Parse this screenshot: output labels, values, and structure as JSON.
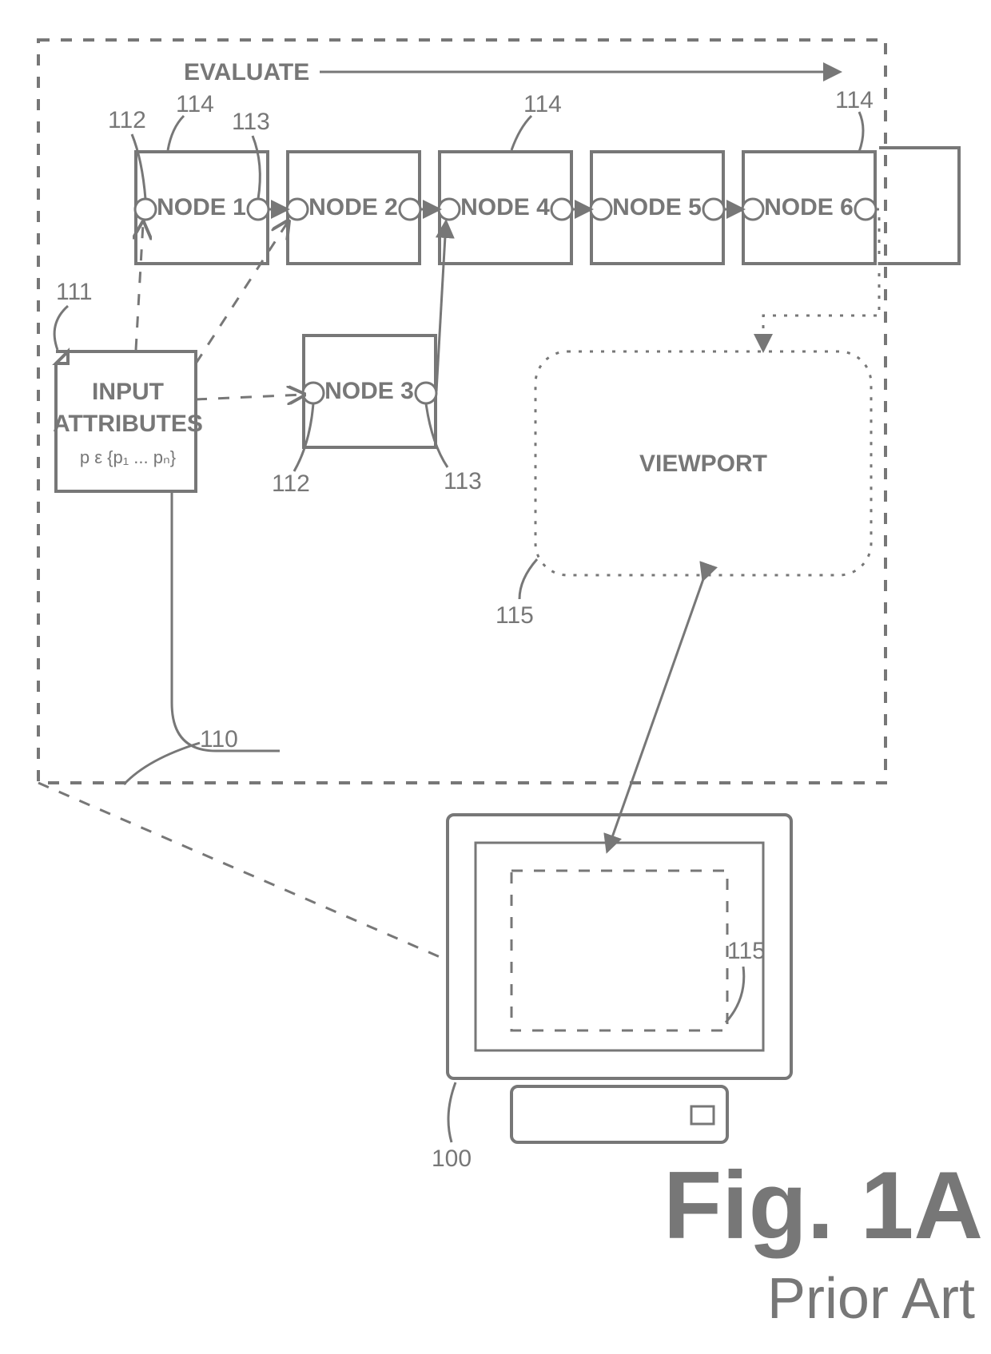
{
  "figure": {
    "title": "Fig. 1A",
    "subtitle": "Prior Art",
    "evaluate": "EVALUATE",
    "input": {
      "line1": "INPUT",
      "line2": "ATTRIBUTES",
      "formula": "p ε {p₁ ... pₙ}"
    },
    "nodes": {
      "n1": "NODE 1",
      "n2": "NODE 2",
      "n3": "NODE 3",
      "n4": "NODE 4",
      "n5": "NODE 5",
      "n6": "NODE 6"
    },
    "viewport": "VIEWPORT",
    "refs": {
      "r100": "100",
      "r110": "110",
      "r111": "111",
      "r112a": "112",
      "r112b": "112",
      "r113a": "113",
      "r113b": "113",
      "r114a": "114",
      "r114b": "114",
      "r114c": "114",
      "r115a": "115",
      "r115b": "115"
    }
  }
}
